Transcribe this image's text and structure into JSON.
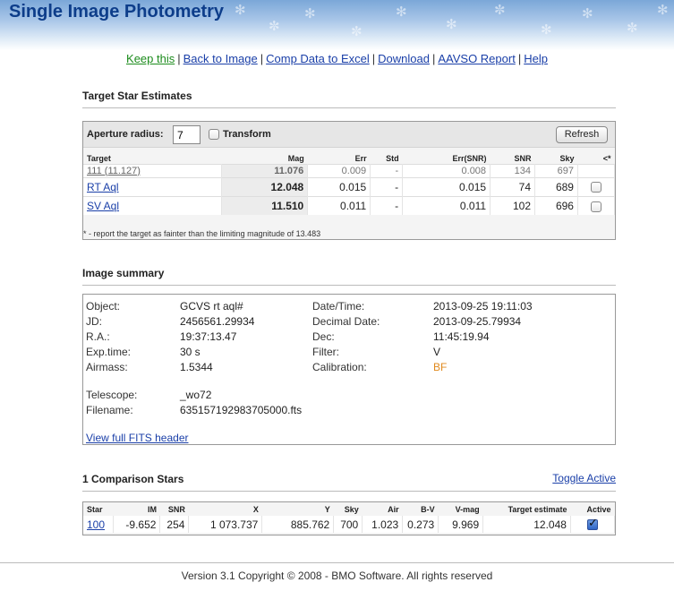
{
  "header": {
    "title": "Single Image Photometry"
  },
  "nav": {
    "items": [
      "Keep this",
      "Back to Image",
      "Comp Data to Excel",
      "Download",
      "AAVSO Report",
      "Help"
    ]
  },
  "target": {
    "section_title": "Target Star Estimates",
    "aperture_label": "Aperture radius:",
    "aperture_value": "7",
    "transform_label": "Transform",
    "refresh_label": "Refresh",
    "columns": [
      "Target",
      "Mag",
      "Err",
      "Std",
      "Err(SNR)",
      "SNR",
      "Sky",
      "<*"
    ],
    "rows": [
      {
        "name": "111 (11.127)",
        "mag": "11.076",
        "err": "0.009",
        "std": "-",
        "err_snr": "0.008",
        "snr": "134",
        "sky": "697"
      },
      {
        "name": "RT Aql",
        "mag": "12.048",
        "err": "0.015",
        "std": "-",
        "err_snr": "0.015",
        "snr": "74",
        "sky": "689"
      },
      {
        "name": "SV Aql",
        "mag": "11.510",
        "err": "0.011",
        "std": "-",
        "err_snr": "0.011",
        "snr": "102",
        "sky": "696"
      }
    ],
    "footnote": "* - report the target as fainter than the limiting magnitude of 13.483"
  },
  "summary": {
    "section_title": "Image summary",
    "left": [
      {
        "label": "Object:",
        "value": "GCVS rt aql#"
      },
      {
        "label": "JD:",
        "value": "2456561.29934"
      },
      {
        "label": "R.A.:",
        "value": "19:37:13.47"
      },
      {
        "label": "Exp.time:",
        "value": "30 s"
      },
      {
        "label": "Airmass:",
        "value": "1.5344"
      }
    ],
    "right": [
      {
        "label": "Date/Time:",
        "value": "2013-09-25 19:11:03"
      },
      {
        "label": "Decimal Date:",
        "value": "2013-09-25.79934"
      },
      {
        "label": "Dec:",
        "value": "11:45:19.94"
      },
      {
        "label": "Filter:",
        "value": "V"
      },
      {
        "label": "Calibration:",
        "value": "BF"
      }
    ],
    "telescope_label": "Telescope:",
    "telescope_value": "_wo72",
    "filename_label": "Filename:",
    "filename_value": "635157192983705000.fts",
    "fits_link": "View full FITS header",
    "calibration_color": "#e08a1e"
  },
  "comparison": {
    "section_title": "1 Comparison Stars",
    "toggle_label": "Toggle Active",
    "columns": [
      "Star",
      "IM",
      "SNR",
      "X",
      "Y",
      "Sky",
      "Air",
      "B-V",
      "V-mag",
      "Target estimate",
      "Active"
    ],
    "rows": [
      {
        "star": "100",
        "im": "-9.652",
        "snr": "254",
        "x": "1 073.737",
        "y": "885.762",
        "sky": "700",
        "air": "1.023",
        "bv": "0.273",
        "vmag": "9.969",
        "estimate": "12.048",
        "active": true
      }
    ]
  },
  "footer": {
    "text": "Version 3.1 Copyright © 2008 - BMO Software. All rights reserved"
  },
  "colors": {
    "link": "#1a3fa8",
    "keep_link": "#1d8c1d",
    "title": "#0d3d8a"
  }
}
